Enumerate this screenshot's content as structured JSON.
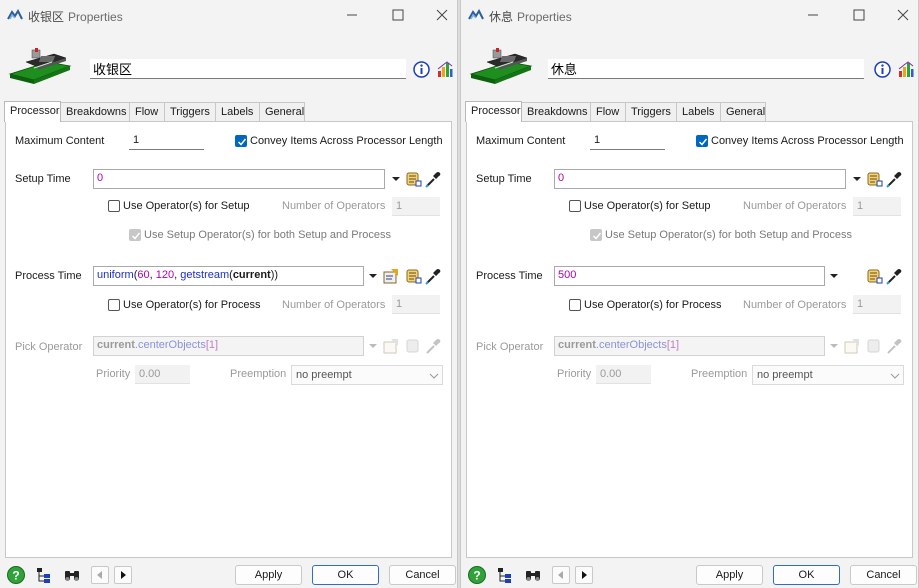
{
  "windows": [
    {
      "title": "收银区",
      "title_suffix": "Properties",
      "name_value": "收银区",
      "tabs": [
        "Processor",
        "Breakdowns",
        "Flow",
        "Triggers",
        "Labels",
        "General"
      ],
      "active_tab": "Processor",
      "max_content_label": "Maximum Content",
      "max_content_value": "1",
      "convey_label": "Convey Items Across Processor Length",
      "convey_checked": true,
      "setup_time_label": "Setup Time",
      "setup_time_value": "0",
      "use_operator_setup_label": "Use Operator(s) for Setup",
      "num_operators_label": "Number of Operators",
      "num_operators_setup_value": "1",
      "use_setup_both_label": "Use Setup Operator(s) for both Setup and Process",
      "process_time_label": "Process Time",
      "process_time_tokens": [
        {
          "t": "uniform",
          "c": "blue"
        },
        {
          "t": "(",
          "c": "plain"
        },
        {
          "t": "60",
          "c": "num"
        },
        {
          "t": ", ",
          "c": "plain"
        },
        {
          "t": "120",
          "c": "num"
        },
        {
          "t": ", ",
          "c": "plain"
        },
        {
          "t": "getstream",
          "c": "blue"
        },
        {
          "t": "(",
          "c": "plain"
        },
        {
          "t": "current",
          "c": "bold"
        },
        {
          "t": "))",
          "c": "plain"
        }
      ],
      "use_operator_process_label": "Use Operator(s) for Process",
      "num_operators_process_value": "1",
      "pick_operator_label": "Pick Operator",
      "pick_operator_tokens": [
        {
          "t": "current",
          "c": "gbold"
        },
        {
          "t": ".centerObjects",
          "c": "gblue"
        },
        {
          "t": "[1]",
          "c": "gnum"
        }
      ],
      "priority_label": "Priority",
      "priority_value": "0.00",
      "preemption_label": "Preemption",
      "preemption_value": "no preempt",
      "apply_label": "Apply",
      "ok_label": "OK",
      "cancel_label": "Cancel"
    },
    {
      "title": "休息",
      "title_suffix": "Properties",
      "name_value": "休息",
      "tabs": [
        "Processor",
        "Breakdowns",
        "Flow",
        "Triggers",
        "Labels",
        "General"
      ],
      "active_tab": "Processor",
      "max_content_label": "Maximum Content",
      "max_content_value": "1",
      "convey_label": "Convey Items Across Processor Length",
      "convey_checked": true,
      "setup_time_label": "Setup Time",
      "setup_time_value": "0",
      "use_operator_setup_label": "Use Operator(s) for Setup",
      "num_operators_label": "Number of Operators",
      "num_operators_setup_value": "1",
      "use_setup_both_label": "Use Setup Operator(s) for both Setup and Process",
      "process_time_label": "Process Time",
      "process_time_tokens": [
        {
          "t": "500",
          "c": "num"
        }
      ],
      "use_operator_process_label": "Use Operator(s) for Process",
      "num_operators_process_value": "1",
      "pick_operator_label": "Pick Operator",
      "pick_operator_tokens": [
        {
          "t": "current",
          "c": "gbold"
        },
        {
          "t": ".centerObjects",
          "c": "gblue"
        },
        {
          "t": "[1]",
          "c": "gnum"
        }
      ],
      "priority_label": "Priority",
      "priority_value": "0.00",
      "preemption_label": "Preemption",
      "preemption_value": "no preempt",
      "apply_label": "Apply",
      "ok_label": "OK",
      "cancel_label": "Cancel"
    }
  ],
  "icons": {
    "app": "flexsim-logo-icon",
    "object": "processor-conveyor-icon",
    "info": "info-icon",
    "stats": "statistics-chart-icon",
    "help": "help-icon",
    "tree": "tree-view-icon",
    "find": "binoculars-icon",
    "prev": "previous-arrow-icon",
    "next": "next-arrow-icon",
    "template": "code-template-icon",
    "eyedropper": "sampler-eyedropper-icon",
    "script": "script-edit-icon",
    "dropdown": "dropdown-arrow-icon"
  },
  "colors": {
    "accent": "#0067c0",
    "code_blue": "#1a2fd0",
    "code_number": "#b000b0"
  }
}
